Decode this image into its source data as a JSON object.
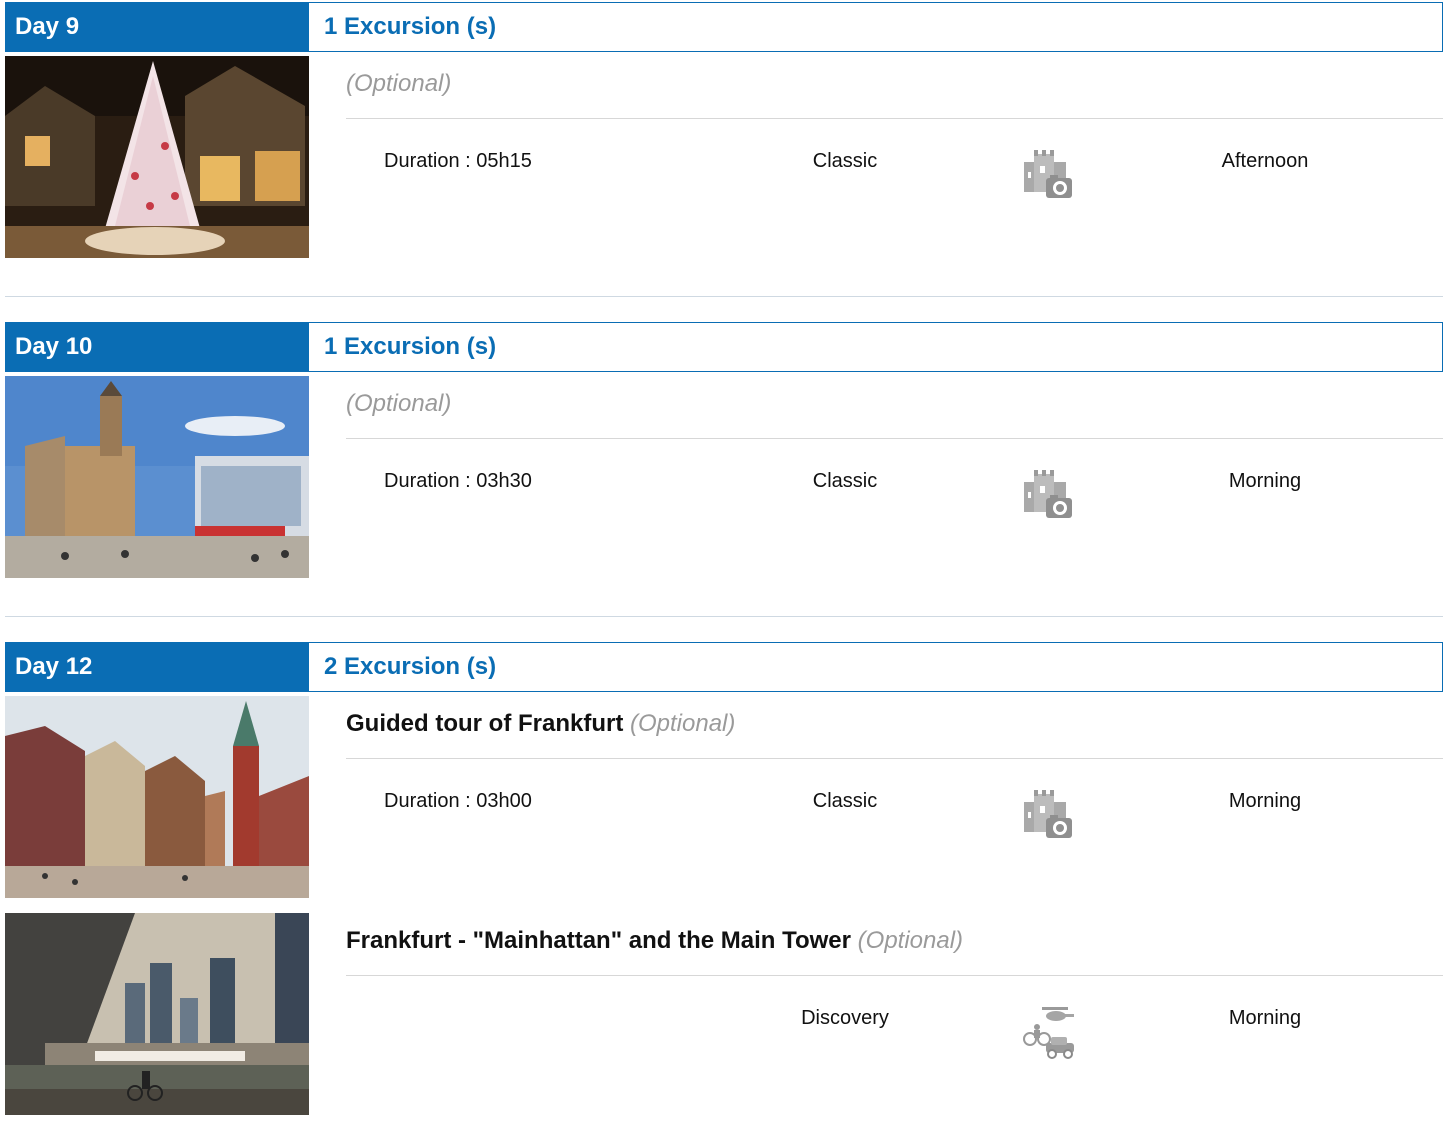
{
  "colors": {
    "accent": "#0a6db4",
    "optional_text": "#9a9a9a"
  },
  "days": [
    {
      "day_label": "Day 9",
      "excursions_label": "1 Excursion (s)",
      "excursions": [
        {
          "title": "",
          "optional": "(Optional)",
          "duration": "Duration : 05h15",
          "category": "Classic",
          "icon": "castle-photo-icon",
          "time": "Afternoon",
          "photo": "christmas-market-tree"
        }
      ]
    },
    {
      "day_label": "Day 10",
      "excursions_label": "1 Excursion (s)",
      "excursions": [
        {
          "title": "",
          "optional": "(Optional)",
          "duration": "Duration : 03h30",
          "category": "Classic",
          "icon": "castle-photo-icon",
          "time": "Morning",
          "photo": "town-square"
        }
      ]
    },
    {
      "day_label": "Day 12",
      "excursions_label": "2 Excursion (s)",
      "excursions": [
        {
          "title": "Guided tour of Frankfurt",
          "optional": "(Optional)",
          "duration": "Duration : 03h00",
          "category": "Classic",
          "icon": "castle-photo-icon",
          "time": "Morning",
          "photo": "romerberg"
        },
        {
          "title": "Frankfurt - \"Mainhattan\" and the Main Tower",
          "optional": "(Optional)",
          "duration": "",
          "category": "Discovery",
          "icon": "transport-activity-icon",
          "time": "Morning",
          "photo": "frankfurt-skyline"
        }
      ]
    }
  ]
}
